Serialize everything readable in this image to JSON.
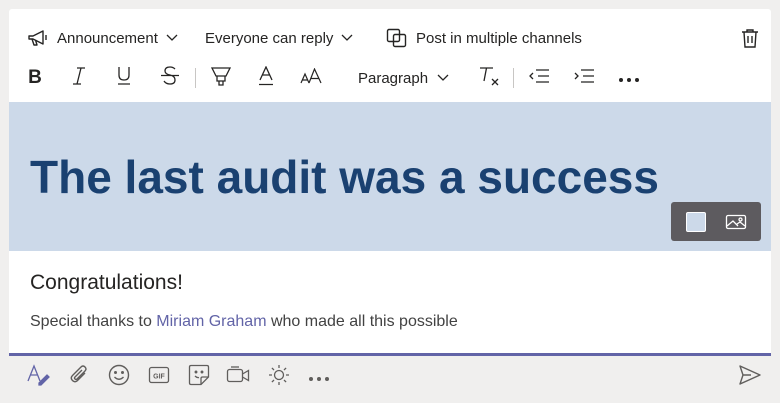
{
  "topbar": {
    "announcement_label": "Announcement",
    "reply_label": "Everyone can reply",
    "multi_channel_label": "Post in multiple channels"
  },
  "format": {
    "paragraph_label": "Paragraph"
  },
  "banner": {
    "headline": "The last audit was a success",
    "background_color": "#ccd9e9",
    "headline_color": "#1a4171"
  },
  "message": {
    "subject": "Congratulations!",
    "body_prefix": "Special thanks to ",
    "mention": "Miriam Graham",
    "body_suffix": " who made all this possible"
  },
  "icons": {
    "announcement": "megaphone-icon",
    "multi_channel": "copy-icon",
    "delete": "trash-icon",
    "send": "send-icon"
  },
  "colors": {
    "accent": "#6264a7",
    "mention": "#6264a7"
  }
}
